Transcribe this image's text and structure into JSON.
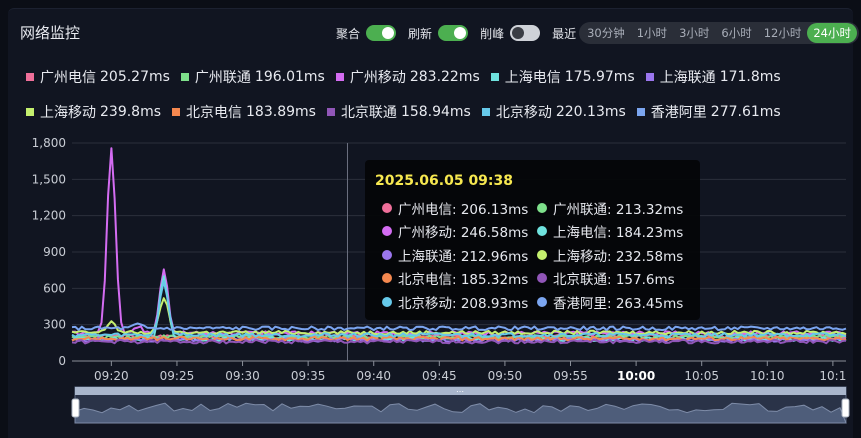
{
  "title": "网络监控",
  "controls": {
    "aggregate": {
      "label": "聚合",
      "on": true
    },
    "refresh": {
      "label": "刷新",
      "on": true
    },
    "peak_cut": {
      "label": "削峰",
      "on": false
    },
    "recent_label": "最近",
    "ranges": [
      "30分钟",
      "1小时",
      "3小时",
      "6小时",
      "12小时",
      "24小时"
    ],
    "active_range": "24小时"
  },
  "legend": [
    {
      "name": "广州电信",
      "value": "205.27ms",
      "color": "#ef6f9a"
    },
    {
      "name": "广州联通",
      "value": "196.01ms",
      "color": "#7ee08b"
    },
    {
      "name": "广州移动",
      "value": "283.22ms",
      "color": "#d46cf2"
    },
    {
      "name": "上海电信",
      "value": "175.97ms",
      "color": "#6fe2de"
    },
    {
      "name": "上海联通",
      "value": "171.8ms",
      "color": "#9b76ee"
    },
    {
      "name": "上海移动",
      "value": "239.8ms",
      "color": "#c4ef6e"
    },
    {
      "name": "北京电信",
      "value": "183.89ms",
      "color": "#f5884f"
    },
    {
      "name": "北京联通",
      "value": "158.94ms",
      "color": "#9156b8"
    },
    {
      "name": "北京移动",
      "value": "220.13ms",
      "color": "#66c9ea"
    },
    {
      "name": "香港阿里",
      "value": "277.61ms",
      "color": "#7ba5f0"
    }
  ],
  "tooltip": {
    "time": "2025.06.05 09:38",
    "items": [
      {
        "name": "广州电信",
        "value": "206.13ms",
        "color": "#ef6f9a"
      },
      {
        "name": "广州联通",
        "value": "213.32ms",
        "color": "#7ee08b"
      },
      {
        "name": "广州移动",
        "value": "246.58ms",
        "color": "#d46cf2"
      },
      {
        "name": "上海电信",
        "value": "184.23ms",
        "color": "#6fe2de"
      },
      {
        "name": "上海联通",
        "value": "212.96ms",
        "color": "#9b76ee"
      },
      {
        "name": "上海移动",
        "value": "232.58ms",
        "color": "#c4ef6e"
      },
      {
        "name": "北京电信",
        "value": "185.32ms",
        "color": "#f5884f"
      },
      {
        "name": "北京联通",
        "value": "157.6ms",
        "color": "#9156b8"
      },
      {
        "name": "北京移动",
        "value": "208.93ms",
        "color": "#66c9ea"
      },
      {
        "name": "香港阿里",
        "value": "263.45ms",
        "color": "#7ba5f0"
      }
    ]
  },
  "chart_data": {
    "type": "line",
    "ylim": [
      0,
      1800
    ],
    "yticks": [
      "0",
      "300",
      "600",
      "900",
      "1,200",
      "1,500",
      "1,800"
    ],
    "xlim": [
      "09:17",
      "10:16"
    ],
    "xticks": [
      "09:20",
      "09:25",
      "09:30",
      "09:35",
      "09:40",
      "09:45",
      "09:50",
      "09:55",
      "10:00",
      "10:05",
      "10:10",
      "10:1"
    ],
    "xticks_bold": [
      "10:00"
    ],
    "cursor_time": "09:38",
    "series": [
      {
        "name": "广州电信",
        "color": "#ef6f9a",
        "baseline": 205,
        "peaks": []
      },
      {
        "name": "广州联通",
        "color": "#7ee08b",
        "baseline": 200,
        "peaks": []
      },
      {
        "name": "广州移动",
        "color": "#d46cf2",
        "baseline": 230,
        "peaks": [
          {
            "t": "09:20",
            "v": 1760
          },
          {
            "t": "09:22",
            "v": 290
          },
          {
            "t": "09:24",
            "v": 750
          }
        ]
      },
      {
        "name": "上海电信",
        "color": "#6fe2de",
        "baseline": 180,
        "peaks": [
          {
            "t": "09:24",
            "v": 700
          }
        ]
      },
      {
        "name": "上海联通",
        "color": "#9b76ee",
        "baseline": 175,
        "peaks": []
      },
      {
        "name": "上海移动",
        "color": "#c4ef6e",
        "baseline": 235,
        "peaks": [
          {
            "t": "09:20",
            "v": 330
          },
          {
            "t": "09:24",
            "v": 530
          }
        ]
      },
      {
        "name": "北京电信",
        "color": "#f5884f",
        "baseline": 185,
        "peaks": []
      },
      {
        "name": "北京联通",
        "color": "#9156b8",
        "baseline": 160,
        "peaks": []
      },
      {
        "name": "北京移动",
        "color": "#66c9ea",
        "baseline": 215,
        "peaks": [
          {
            "t": "09:24",
            "v": 660
          }
        ]
      },
      {
        "name": "香港阿里",
        "color": "#7ba5f0",
        "baseline": 270,
        "peaks": [
          {
            "t": "09:22",
            "v": 300
          }
        ]
      }
    ]
  }
}
